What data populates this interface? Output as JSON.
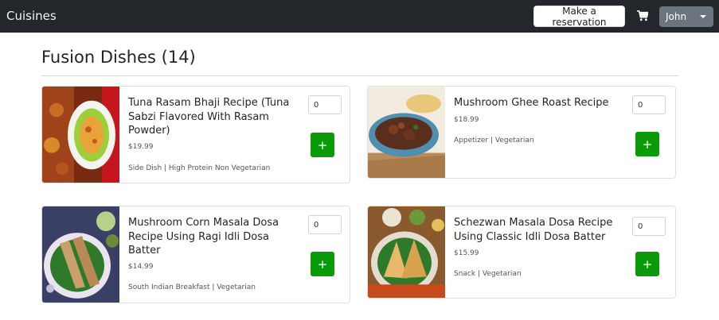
{
  "navbar": {
    "brand": "Cuisines",
    "reservation_label": "Make a reservation",
    "cart_icon": "shopping-cart-icon",
    "user_label": "John"
  },
  "page": {
    "title": "Fusion Dishes (14)"
  },
  "dishes": [
    {
      "name_lines": [
        "Tuna Rasam Bhaji Recipe (Tuna",
        "Sabzi Flavored With Rasam",
        "Powder)"
      ],
      "price": "$19.99",
      "tags": "Side Dish | High Protein Non Vegetarian",
      "quantity": "0",
      "add_label": "+"
    },
    {
      "name_lines": [
        "Mushroom Ghee Roast Recipe"
      ],
      "price": "$18.99",
      "tags": "Appetizer | Vegetarian",
      "quantity": "0",
      "add_label": "+"
    },
    {
      "name_lines": [
        "Mushroom Corn Masala Dosa",
        "Recipe Using Ragi Idli Dosa",
        "Batter"
      ],
      "price": "$14.99",
      "tags": "South Indian Breakfast | Vegetarian",
      "quantity": "0",
      "add_label": "+"
    },
    {
      "name_lines": [
        "Schezwan Masala Dosa Recipe",
        "Using Classic Idli Dosa Batter"
      ],
      "price": "$15.99",
      "tags": "Snack | Vegetarian",
      "quantity": "0",
      "add_label": "+"
    }
  ]
}
